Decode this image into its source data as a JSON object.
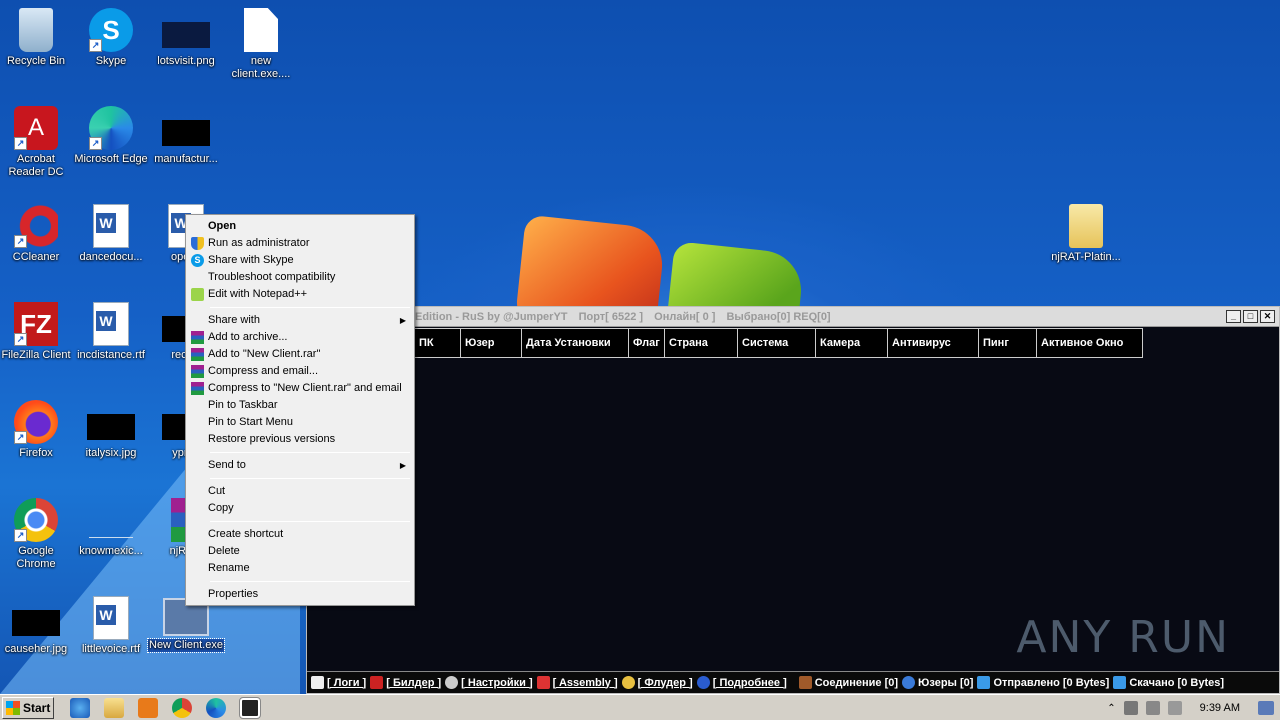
{
  "desktop_icons": [
    {
      "label": "Recycle Bin",
      "icon": "recycle-bin-icon"
    },
    {
      "label": "Skype",
      "icon": "skype-icon"
    },
    {
      "label": "lotsvisit.png",
      "icon": "image-file-icon"
    },
    {
      "label": "new client.exe....",
      "icon": "blank-file-icon"
    },
    {
      "label": "Acrobat Reader DC",
      "icon": "acrobat-icon"
    },
    {
      "label": "Microsoft Edge",
      "icon": "edge-icon"
    },
    {
      "label": "manufactur...",
      "icon": "image-file-icon"
    },
    {
      "label": "CCleaner",
      "icon": "ccleaner-icon"
    },
    {
      "label": "dancedocu...",
      "icon": "word-doc-icon"
    },
    {
      "label": "openc",
      "icon": "word-doc-icon"
    },
    {
      "label": "FileZilla Client",
      "icon": "filezilla-icon"
    },
    {
      "label": "incdistance.rtf",
      "icon": "word-doc-icon"
    },
    {
      "label": "receiv",
      "icon": "image-file-icon"
    },
    {
      "label": "Firefox",
      "icon": "firefox-icon"
    },
    {
      "label": "italysix.jpg",
      "icon": "image-file-icon"
    },
    {
      "label": "yprod",
      "icon": "image-file-icon"
    },
    {
      "label": "Google Chrome",
      "icon": "chrome-icon"
    },
    {
      "label": "knowmexic...",
      "icon": "file-icon"
    },
    {
      "label": "njRAT-",
      "icon": "winrar-icon"
    },
    {
      "label": "causeher.jpg",
      "icon": "image-file-icon"
    },
    {
      "label": "littlevoice.rtf",
      "icon": "word-doc-icon"
    },
    {
      "label": "New Client.exe",
      "icon": "exe-icon"
    },
    {
      "label": "njRAT-Platin...",
      "icon": "folder-icon"
    }
  ],
  "context_menu": {
    "items": [
      "Open",
      "Run as administrator",
      "Share with Skype",
      "Troubleshoot compatibility",
      "Edit with Notepad++",
      "Share with",
      "Add to archive...",
      "Add to \"New Client.rar\"",
      "Compress and email...",
      "Compress to \"New Client.rar\" and email",
      "Pin to Taskbar",
      "Pin to Start Menu",
      "Restore previous versions",
      "Send to",
      "Cut",
      "Copy",
      "Create shortcut",
      "Delete",
      "Rename",
      "Properties"
    ]
  },
  "rat_window": {
    "title_parts": [
      "Edition - RuS by @JumperYT",
      "Порт[ 6522 ]",
      "Онлайн[ 0 ]",
      "Выбрано[0] REQ[0]"
    ],
    "columns": [
      "пи",
      "ПК",
      "Юзер",
      "Дата Установки",
      "Флаг",
      "Страна",
      "Система",
      "Камера",
      "Антивирус",
      "Пинг",
      "Активное Окно"
    ],
    "status": [
      "[ Логи ]",
      "[ Билдер ]",
      "[ Настройки ]",
      "[ Assembly ]",
      "[ Флудер ]",
      "[ Подробнее ]",
      "Соединение [0]",
      "Юзеры [0]",
      "Отправлено [0 Bytes]",
      "Скачано [0 Bytes]"
    ]
  },
  "watermark": "ANY RUN",
  "taskbar": {
    "start_label": "Start",
    "clock": "9:39 AM"
  }
}
